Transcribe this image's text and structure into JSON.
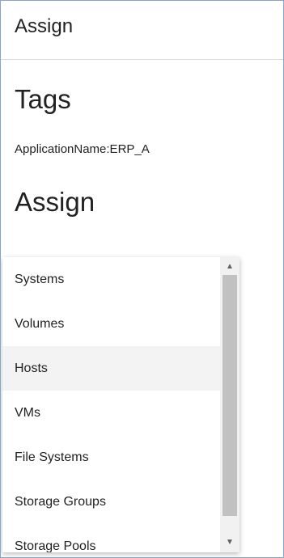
{
  "header": {
    "title": "Assign"
  },
  "tags": {
    "title": "Tags",
    "items": [
      "ApplicationName:ERP_A"
    ]
  },
  "assign": {
    "title": "Assign"
  },
  "dropdown": {
    "options": [
      {
        "label": "Systems"
      },
      {
        "label": "Volumes"
      },
      {
        "label": "Hosts"
      },
      {
        "label": "VMs"
      },
      {
        "label": "File Systems"
      },
      {
        "label": "Storage Groups"
      },
      {
        "label": "Storage Pools"
      }
    ],
    "scroll_up_icon": "triangle-up",
    "scroll_down_icon": "triangle-down"
  },
  "colors": {
    "frame_border": "#8aa4c8",
    "option_shaded": "#f3f3f3",
    "scrollbar_thumb": "#c1c1c1",
    "text": "#222222"
  }
}
